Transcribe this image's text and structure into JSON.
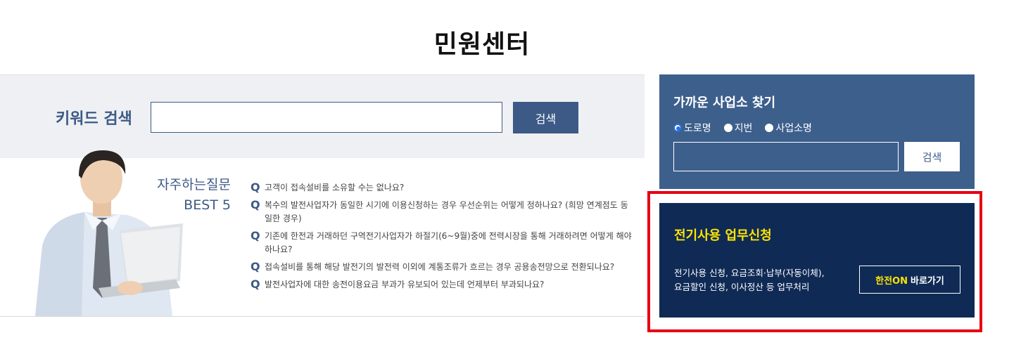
{
  "page": {
    "title": "민원센터"
  },
  "keyword_search": {
    "label": "키워드 검색",
    "input_value": "",
    "button_label": "검색"
  },
  "faq": {
    "title": "자주하는질문",
    "subtitle": "BEST 5",
    "marker": "Q",
    "items": [
      {
        "text": "고객이 접속설비를 소유할 수는 없나요?"
      },
      {
        "text": "복수의 발전사업자가 동일한 시기에 이용신청하는 경우 우선순위는 어떻게 정하나요? (희망 연계점도 동일한 경우)"
      },
      {
        "text": "기존에 한전과 거래하던 구역전기사업자가 하절기(6~9월)중에 전력시장을 통해 거래하려면 어떻게 해야 하나요?"
      },
      {
        "text": "접속설비를 통해 해당 발전기의 발전력 이외에 계통조류가 흐르는 경우 공용송전망으로 전환되나요?"
      },
      {
        "text": "발전사업자에 대한 송전이용요금 부과가 유보되어 있는데 언제부터 부과되나요?"
      }
    ]
  },
  "office_finder": {
    "title": "가까운 사업소 찾기",
    "radios": [
      {
        "label": "도로명",
        "checked": true
      },
      {
        "label": "지번",
        "checked": false
      },
      {
        "label": "사업소명",
        "checked": false
      }
    ],
    "input_value": "",
    "button_label": "검색"
  },
  "service": {
    "title": "전기사용 업무신청",
    "desc_line1": "전기사용 신청, 요금조회·납부(자동이체),",
    "desc_line2": "요금할인 신청, 이사정산 등 업무처리",
    "button_brand": "한전ON",
    "button_label": "바로가기"
  },
  "colors": {
    "primary": "#3d5a86",
    "service_bg": "#0f2a55",
    "highlight": "#e60012",
    "accent_yellow": "#ffe400"
  }
}
